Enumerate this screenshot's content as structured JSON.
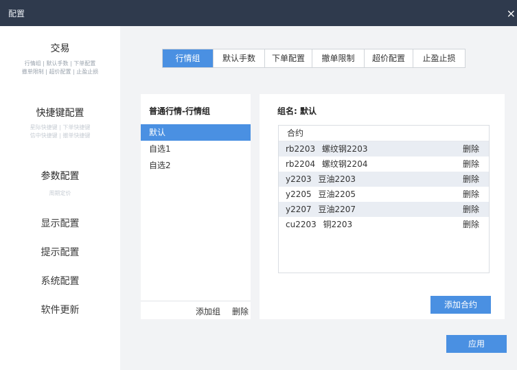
{
  "window": {
    "title": "配置",
    "close_glyph": "×"
  },
  "sidebar": {
    "trade": {
      "title": "交易",
      "sub_line1": "行情组 | 默认手数 | 下单配置",
      "sub_line2": "撤单限制 | 超价配置 | 止盈止损"
    },
    "hotkey": {
      "title": "快捷键配置",
      "sub_line1": "星际快捷键 | 下单快捷键",
      "sub_line2": "信中快捷键 | 撤单快捷键"
    },
    "params": {
      "title": "参数配置",
      "sub": "周期定价"
    },
    "menu": [
      {
        "label": "显示配置"
      },
      {
        "label": "提示配置"
      },
      {
        "label": "系统配置"
      },
      {
        "label": "软件更新"
      }
    ]
  },
  "tabs": [
    {
      "label": "行情组",
      "active": true
    },
    {
      "label": "默认手数",
      "active": false
    },
    {
      "label": "下单配置",
      "active": false
    },
    {
      "label": "撤单限制",
      "active": false
    },
    {
      "label": "超价配置",
      "active": false
    },
    {
      "label": "止盈止损",
      "active": false
    }
  ],
  "group_panel": {
    "title": "普通行情-行情组",
    "items": [
      {
        "label": "默认",
        "active": true
      },
      {
        "label": "自选1",
        "active": false
      },
      {
        "label": "自选2",
        "active": false
      }
    ],
    "add_label": "添加组",
    "delete_label": "删除"
  },
  "contract_panel": {
    "group_name": "组名: 默认",
    "header": "合约",
    "rows": [
      {
        "code": "rb2203",
        "name": "螺纹钢2203",
        "delete": "删除"
      },
      {
        "code": "rb2204",
        "name": "螺纹钢2204",
        "delete": "删除"
      },
      {
        "code": "y2203",
        "name": "豆油2203",
        "delete": "删除"
      },
      {
        "code": "y2205",
        "name": "豆油2205",
        "delete": "删除"
      },
      {
        "code": "y2207",
        "name": "豆油2207",
        "delete": "删除"
      },
      {
        "code": "cu2203",
        "name": "铜2203",
        "delete": "删除"
      }
    ],
    "add_contract_label": "添加合约"
  },
  "apply_label": "应用",
  "colors": {
    "accent": "#4a90e2",
    "titlebar": "#2f3a4d",
    "content_bg": "#f2f3f5",
    "row_alt": "#e9edf3"
  }
}
